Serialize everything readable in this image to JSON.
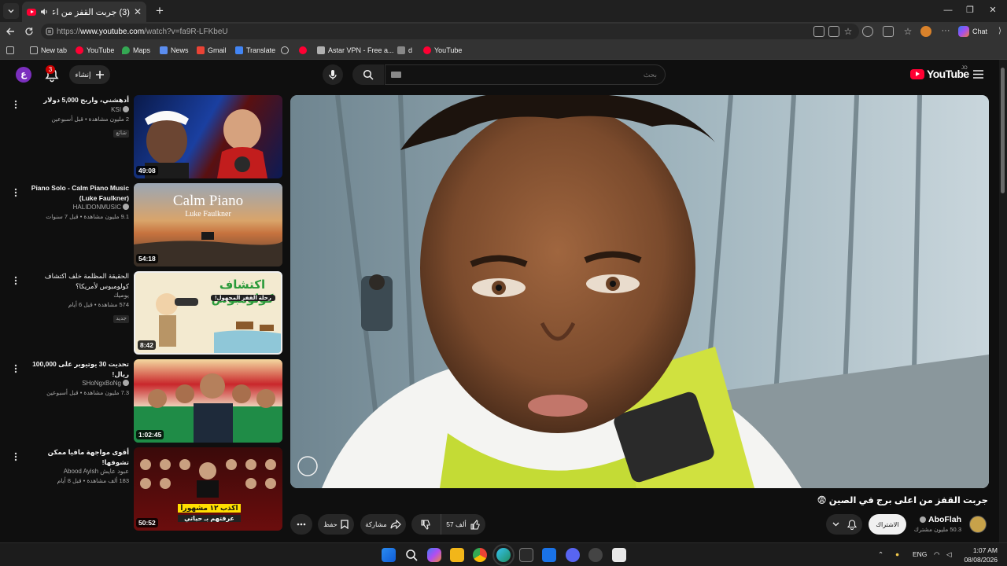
{
  "browser": {
    "tab_title": "(3) جربت القفز من اعلى برج في الصين",
    "url_prefix": "https://",
    "url_host": "www.youtube.com",
    "url_path": "/watch?v=fa9R-LFKbeU",
    "chat_label": "Chat",
    "bookmarks": [
      "New tab",
      "YouTube",
      "Maps",
      "News",
      "Gmail",
      "Translate",
      "Astar VPN - Free a...",
      "d",
      "YouTube"
    ]
  },
  "header": {
    "avatar_letter": "ع",
    "notification_count": "3",
    "create_label": "إنشاء",
    "search_placeholder": "بحث",
    "logo_text": "YouTube",
    "country_code": "JO"
  },
  "recommendations": [
    {
      "title": "أدهشني، واربح 5,000 دولار",
      "channel": "KSI",
      "meta": "2 مليون مشاهدة • قبل أسبوعين",
      "badge": "شائع",
      "duration": "49:08"
    },
    {
      "title": "Piano Solo - Calm Piano Music (Luke Faulkner)",
      "channel": "HALIDONMUSIC",
      "meta": "9.1 مليون مشاهدة • قبل 7 سنوات",
      "badge": "",
      "duration": "54:18",
      "thumb_title": "Calm Piano",
      "thumb_sub": "Luke Faulkner"
    },
    {
      "title": "الحقيقة المظلمة خلف اكتشاف كولومبوس لأمريكا؟",
      "channel": "يوميك",
      "meta": "574 مشاهدة • قبل 6 أيام",
      "badge": "جديد",
      "duration": "8:42",
      "thumb_title": "اكتشاف كولومبوس",
      "thumb_sub": "رحلة القفز المجهول!"
    },
    {
      "title": "تحديت 30 يوتيوبر على 100,000 ريال!",
      "channel": "SHoNgxBoNg",
      "meta": "7.3 مليون مشاهدة • قبل أسبوعين",
      "badge": "",
      "duration": "1:02:45"
    },
    {
      "title": "أقوى مواجهة مافيا ممكن تشوفها!",
      "channel": "Abood Ayish عبود عايش",
      "meta": "183 ألف مشاهدة • قبل 8 أيام",
      "badge": "",
      "duration": "50:52",
      "thumb_title": "اكذب ١٢ مشهوراً",
      "thumb_sub": "عرفتهم بـ حياتي"
    }
  ],
  "video": {
    "title": "جربت القفز من اعلى برج في الصين 😨",
    "channel_name": "AboFlah",
    "subscribers": "50.3 مليون مشترك",
    "subscribe_label": "الاشتراك",
    "like_count": "57 ألف",
    "share_label": "مشاركة",
    "save_label": "حفظ"
  },
  "taskbar": {
    "lang": "ENG",
    "time": "1:07 AM",
    "date": "08/08/2026"
  },
  "colors": {
    "youtube_red": "#ff0033",
    "page_bg": "#0f0f0f",
    "pill_bg": "#272727"
  }
}
